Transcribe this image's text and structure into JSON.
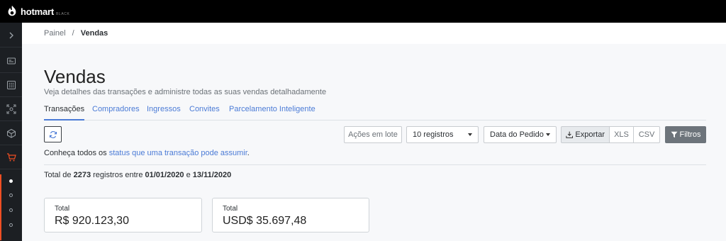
{
  "brand": {
    "name": "hotmart",
    "tier": "BLACK"
  },
  "breadcrumb": {
    "parent": "Painel",
    "separator": "/",
    "current": "Vendas"
  },
  "page": {
    "title": "Vendas",
    "subtitle": "Veja detalhes das transações e administre todas as suas vendas detalhadamente"
  },
  "tabs": [
    {
      "label": "Transações",
      "active": true
    },
    {
      "label": "Compradores"
    },
    {
      "label": "Ingressos"
    },
    {
      "label": "Convites"
    },
    {
      "label": "Parcelamento Inteligente"
    }
  ],
  "toolbar": {
    "refresh_icon": "refresh-icon",
    "bulk_actions": "Ações em lote",
    "records_select": "10 registros",
    "date_select": "Data do Pedido",
    "export": "Exportar",
    "xls": "XLS",
    "csv": "CSV",
    "filters": "Filtros"
  },
  "info": {
    "prefix": "Conheça todos os ",
    "link": "status que uma transação pode assumir",
    "suffix": "."
  },
  "summary": {
    "prefix": "Total de ",
    "count": "2273",
    "middle": " registros entre ",
    "start_date": "01/01/2020",
    "and": " e ",
    "end_date": "13/11/2020"
  },
  "cards": [
    {
      "label": "Total",
      "value": "R$ 920.123,30"
    },
    {
      "label": "Total",
      "value": "USD$ 35.697,48"
    }
  ],
  "colors": {
    "accent": "#4b7bd6",
    "sidebar_active": "#ef4e23",
    "topbar": "#000000",
    "filter_button": "#6d747b"
  }
}
